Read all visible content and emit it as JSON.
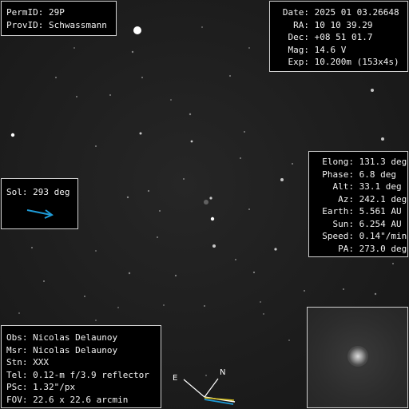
{
  "object": {
    "perm_label": "PermID:",
    "perm_value": "29P",
    "prov_label": "ProvID:",
    "prov_value": "Schwassmann"
  },
  "observation": {
    "date_label": "Date:",
    "date_value": "2025 01 03.26648",
    "ra_label": "RA:",
    "ra_value": "10 10 39.29",
    "dec_label": "Dec:",
    "dec_value": "+08 51 01.7",
    "mag_label": "Mag:",
    "mag_value": "14.6 V",
    "exp_label": "Exp:",
    "exp_value": "10.200m (153x4s)"
  },
  "geometry": {
    "elong_label": "Elong:",
    "elong_value": "131.3 deg",
    "phase_label": "Phase:",
    "phase_value": "6.8 deg",
    "alt_label": "Alt:",
    "alt_value": "33.1 deg",
    "az_label": "Az:",
    "az_value": "242.1 deg",
    "earth_label": "Earth:",
    "earth_value": "5.561 AU",
    "sun_label": "Sun:",
    "sun_value": "6.254 AU",
    "speed_label": "Speed:",
    "speed_value": "0.14\"/min",
    "pa_label": "PA:",
    "pa_value": "273.0 deg"
  },
  "sol": {
    "label": "Sol:",
    "value": "293 deg",
    "arrow_color": "#1e9bd7",
    "arrow_icon": "sun-direction-arrow-icon"
  },
  "observer": {
    "obs_label": "Obs:",
    "obs_value": "Nicolas Delaunoy",
    "msr_label": "Msr:",
    "msr_value": "Nicolas Delaunoy",
    "stn_label": "Stn:",
    "stn_value": "XXX",
    "tel_label": "Tel:",
    "tel_value": "0.12-m f/3.9 reflector",
    "psc_label": "PSc:",
    "psc_value": "1.32\"/px",
    "fov_label": "FOV:",
    "fov_value": "22.6 x 22.6 arcmin"
  },
  "compass": {
    "east_label": "E",
    "north_label": "N",
    "line_color": "#ffffff",
    "tail_yellow": "#d6c020",
    "tail_blue": "#1e9bd7"
  },
  "inset": {
    "description_icon": "comet-zoom-inset"
  }
}
